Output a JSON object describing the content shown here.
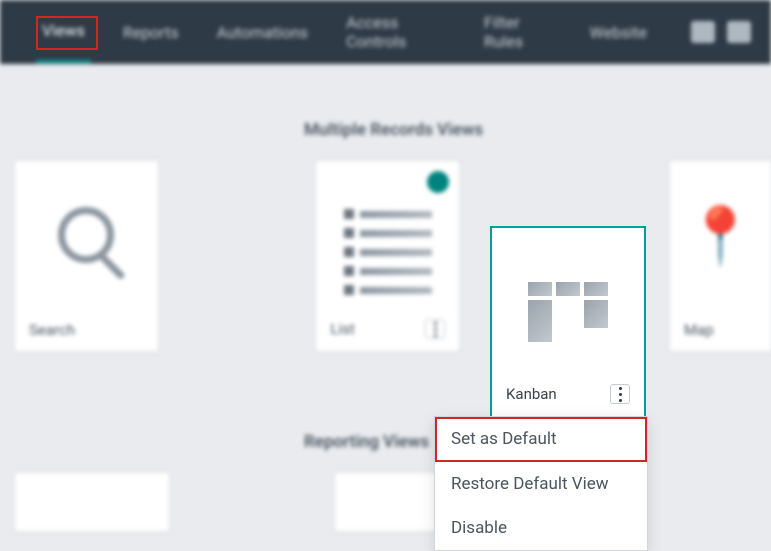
{
  "topbar": {
    "tabs": [
      {
        "label": "Views",
        "active": true
      },
      {
        "label": "Reports"
      },
      {
        "label": "Automations"
      },
      {
        "label": "Access Controls"
      },
      {
        "label": "Filter Rules"
      },
      {
        "label": "Website"
      }
    ]
  },
  "sections": {
    "multiple": {
      "title": "Multiple Records Views"
    },
    "reporting": {
      "title": "Reporting Views"
    }
  },
  "cards": {
    "search": {
      "label": "Search"
    },
    "list": {
      "label": "List"
    },
    "kanban": {
      "label": "Kanban"
    },
    "map": {
      "label": "Map"
    }
  },
  "menu": {
    "set_default": "Set as Default",
    "restore": "Restore Default View",
    "disable": "Disable"
  }
}
